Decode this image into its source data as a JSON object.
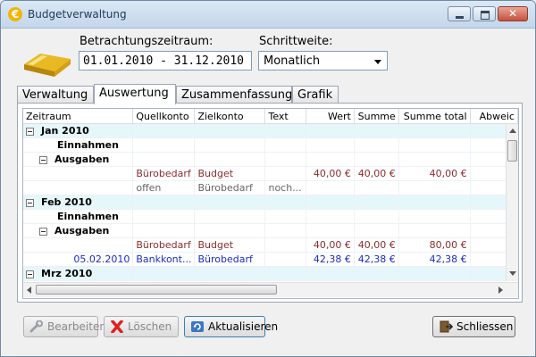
{
  "window": {
    "title": "Budgetverwaltung",
    "icon": "euro-icon"
  },
  "form": {
    "period_label": "Betrachtungszeitraum:",
    "period_value": "01.01.2010  -  31.12.2010",
    "step_label": "Schrittweite:",
    "step_value": "Monatlich"
  },
  "tabs": [
    {
      "label": "Verwaltung",
      "active": false
    },
    {
      "label": "Auswertung",
      "active": true
    },
    {
      "label": "Zusammenfassung",
      "active": false
    },
    {
      "label": "Grafik",
      "active": false
    }
  ],
  "table": {
    "columns": [
      "Zeitraum",
      "Quellkonto",
      "Zielkonto",
      "Text",
      "Wert",
      "Summe",
      "Summe total",
      "Abweic"
    ],
    "rows": {
      "jan": {
        "label": "Jan 2010"
      },
      "jan_income": {
        "label": "Einnahmen"
      },
      "jan_expenses": {
        "label": "Ausgaben"
      },
      "jan_r1": {
        "source": "Bürobedarf",
        "target": "Budget",
        "text": "",
        "value": "40,00 €",
        "sum": "40,00 €",
        "total": "40,00 €"
      },
      "jan_r2": {
        "source": "offen",
        "target": "Bürobedarf",
        "text": "noch..."
      },
      "feb": {
        "label": "Feb 2010"
      },
      "feb_income": {
        "label": "Einnahmen"
      },
      "feb_expenses": {
        "label": "Ausgaben"
      },
      "feb_r1": {
        "source": "Bürobedarf",
        "target": "Budget",
        "value": "40,00 €",
        "sum": "40,00 €",
        "total": "80,00 €"
      },
      "feb_r2": {
        "date": "05.02.2010",
        "source": "Bankkont...",
        "target": "Bürobedarf",
        "value": "42,38 €",
        "sum": "42,38 €",
        "total": "42,38 €"
      },
      "mar": {
        "label": "Mrz 2010"
      }
    }
  },
  "buttons": {
    "edit": "Bearbeiten",
    "delete": "Löschen",
    "refresh": "Aktualisieren",
    "close": "Schliessen"
  },
  "colors": {
    "month_row_bg": "#e6f7fc",
    "planned_text": "#8b2d2d",
    "booked_text": "#1a2ec0",
    "selection": "#3d8ee8"
  }
}
